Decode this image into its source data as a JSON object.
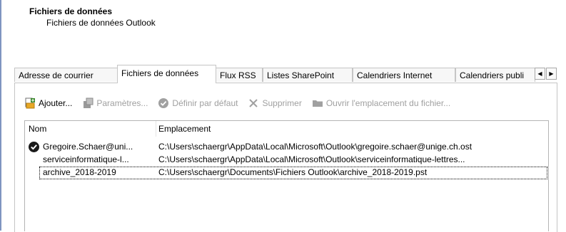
{
  "header": {
    "title": "Fichiers de données",
    "subtitle": "Fichiers de données Outlook"
  },
  "tabs": [
    {
      "label": "Adresse de courrier",
      "active": false
    },
    {
      "label": "Fichiers de données",
      "active": true
    },
    {
      "label": "Flux RSS",
      "active": false
    },
    {
      "label": "Listes SharePoint",
      "active": false
    },
    {
      "label": "Calendriers Internet",
      "active": false
    },
    {
      "label": "Calendriers publi",
      "active": false
    }
  ],
  "toolbar": {
    "add": "Ajouter...",
    "settings": "Paramètres...",
    "default": "Définir par défaut",
    "remove": "Supprimer",
    "open_location": "Ouvrir l'emplacement du fichier..."
  },
  "list": {
    "col_name": "Nom",
    "col_location": "Emplacement",
    "rows": [
      {
        "name": "Gregoire.Schaer@uni...",
        "location": "C:\\Users\\schaergr\\AppData\\Local\\Microsoft\\Outlook\\gregoire.schaer@unige.ch.ost",
        "default": true
      },
      {
        "name": "serviceinformatique-l...",
        "location": "C:\\Users\\schaergr\\AppData\\Local\\Microsoft\\Outlook\\serviceinformatique-lettres...",
        "default": false
      },
      {
        "name": "archive_2018-2019",
        "location": "C:\\Users\\schaergr\\Documents\\Fichiers Outlook\\archive_2018-2019.pst",
        "default": false
      }
    ]
  },
  "colors": {
    "accent": "#2b579a",
    "disabled": "#a0a0a0",
    "border": "#c5c5c5"
  },
  "icons": {
    "add": "add-file-icon",
    "settings": "settings-icon",
    "default": "checkmark-circle-icon",
    "remove": "x-delete-icon",
    "open_location": "folder-icon",
    "default_marker": "checkmark-circle-icon"
  }
}
